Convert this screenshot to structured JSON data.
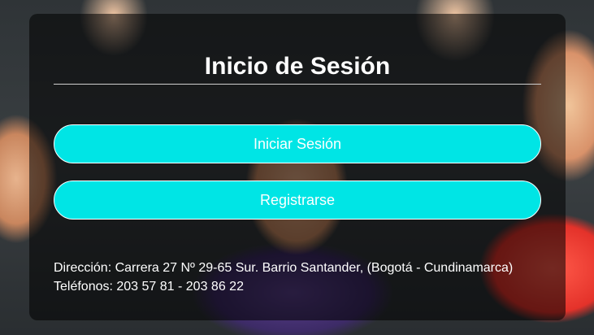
{
  "login_card": {
    "title": "Inicio de Sesión",
    "login_button": "Iniciar Sesión",
    "register_button": "Registrarse"
  },
  "footer": {
    "address": "Dirección: Carrera 27 Nº 29-65 Sur. Barrio Santander, (Bogotá - Cundinamarca)",
    "phones": "Teléfonos: 203 57 81 - 203 86 22"
  },
  "colors": {
    "button_bg": "#00e5e5",
    "overlay": "rgba(0,0,0,0.55)",
    "text": "#ffffff"
  }
}
